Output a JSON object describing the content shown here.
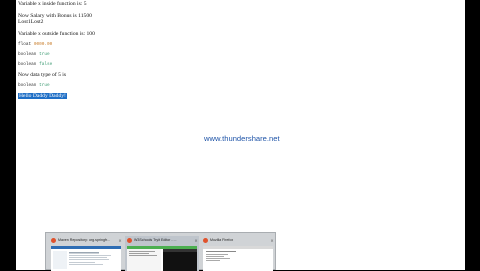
{
  "page": {
    "lines": {
      "line1": "Variable x inside function is: 5",
      "line2": "Now Salary with Bonus is 11500",
      "line3": "Lost1Lost2",
      "line4": "Variable x outside function is: 100"
    },
    "code": {
      "c1_type": "float",
      "c1_value": "0000.00",
      "c2_type": "boolean",
      "c2_value": "true",
      "c3_type": "boolean",
      "c3_value": "false"
    },
    "line5": "Now data type of 5 is",
    "code4": {
      "type": "boolean",
      "value": "true"
    },
    "selected": "Hello Daddy Daddy!"
  },
  "watermark": "www.thundershare.net",
  "taskbar_preview": {
    "windows": [
      {
        "title": "Maven Repository: org.springfr...",
        "icon_color": "#e0522c",
        "close": "×"
      },
      {
        "title": "W3Schools Tryit Editor - ...",
        "icon_color": "#e0522c",
        "close": "×"
      },
      {
        "title": "Mozilla Firefox",
        "icon_color": "#e0522c",
        "close": "×"
      }
    ]
  },
  "colors": {
    "background": "#000000",
    "page": "#ffffff",
    "selection": "#1f6fc6",
    "watermark": "#1f54a8"
  }
}
